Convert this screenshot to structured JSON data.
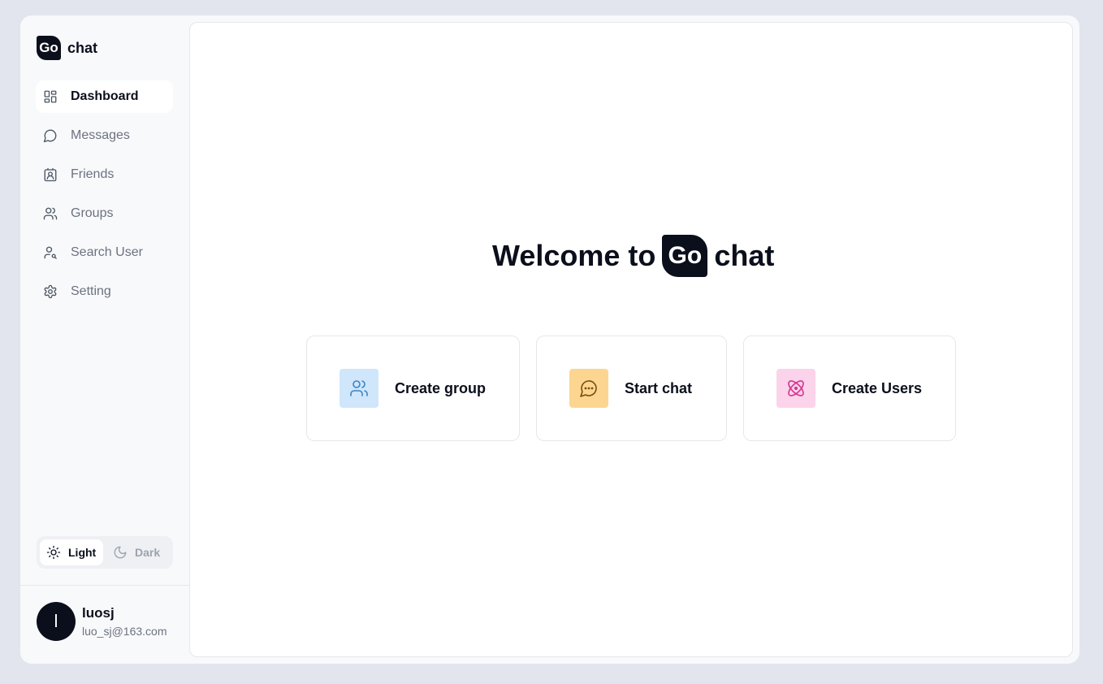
{
  "brand": {
    "badge": "Go",
    "name": "chat"
  },
  "sidebar": {
    "items": [
      {
        "label": "Dashboard",
        "icon": "dashboard-icon",
        "active": true
      },
      {
        "label": "Messages",
        "icon": "message-icon",
        "active": false
      },
      {
        "label": "Friends",
        "icon": "contact-icon",
        "active": false
      },
      {
        "label": "Groups",
        "icon": "users-icon",
        "active": false
      },
      {
        "label": "Search User",
        "icon": "user-search-icon",
        "active": false
      },
      {
        "label": "Setting",
        "icon": "gear-icon",
        "active": false
      }
    ]
  },
  "theme": {
    "light_label": "Light",
    "dark_label": "Dark",
    "selected": "Light"
  },
  "user": {
    "initial": "l",
    "name": "luosj",
    "email": "luo_sj@163.com"
  },
  "main": {
    "welcome_prefix": "Welcome to",
    "welcome_badge": "Go",
    "welcome_suffix": "chat",
    "cards": [
      {
        "label": "Create group",
        "icon": "users-icon",
        "color": "#cfe6fb",
        "stroke": "#3b82c4"
      },
      {
        "label": "Start chat",
        "icon": "chat-bubble-icon",
        "color": "#fcd690",
        "stroke": "#7a4a12"
      },
      {
        "label": "Create Users",
        "icon": "atom-icon",
        "color": "#fbd3ea",
        "stroke": "#d5338f"
      }
    ]
  },
  "colors": {
    "ink": "#0b0f1c",
    "muted": "#6b7280",
    "background": "#e2e5ee"
  }
}
